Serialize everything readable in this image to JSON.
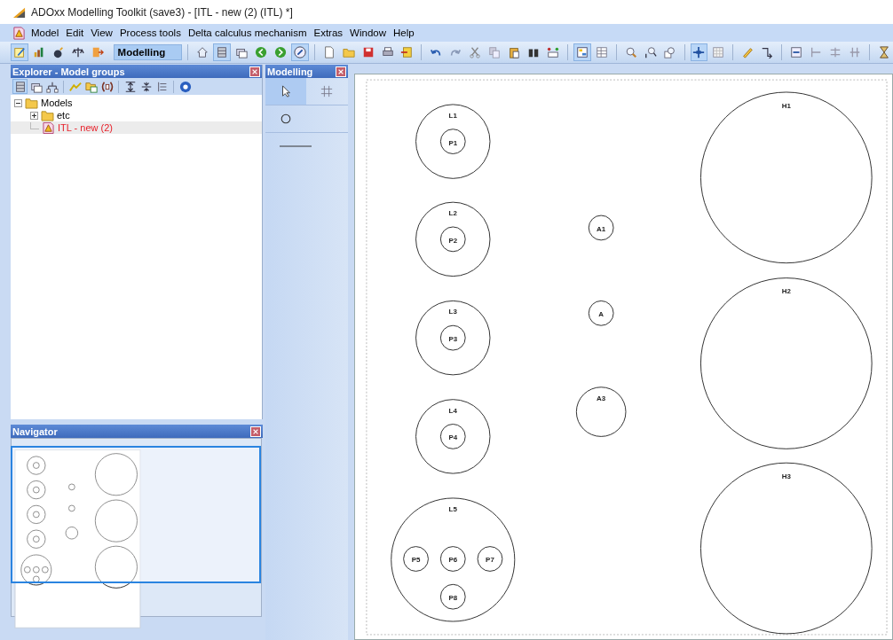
{
  "window": {
    "title": "ADOxx Modelling Toolkit (save3) - [ITL - new (2) (ITL) *]"
  },
  "menu": [
    "Model",
    "Edit",
    "View",
    "Process tools",
    "Delta calculus mechanism",
    "Extras",
    "Window",
    "Help"
  ],
  "toolbar": {
    "left_buttons": [
      {
        "pressed": true
      },
      {
        "pressed": false
      },
      {
        "pressed": false
      },
      {
        "pressed": false
      },
      {
        "pressed": false
      }
    ],
    "mode_field": {
      "value": "Modelling"
    },
    "buttons": [
      {
        "pressed": false
      },
      {
        "pressed": true
      },
      {
        "pressed": false
      },
      {
        "pressed": false
      },
      {
        "pressed": false
      },
      {
        "pressed": true
      },
      {
        "pressed": false
      },
      {
        "pressed": false
      },
      {
        "pressed": false
      },
      {
        "pressed": false
      },
      {
        "pressed": false
      },
      {
        "pressed": false
      },
      {
        "pressed": false
      },
      {
        "pressed": false
      },
      {
        "pressed": false
      },
      {
        "pressed": false
      },
      {
        "pressed": false
      },
      {
        "pressed": false
      },
      {
        "pressed": true
      },
      {
        "pressed": false
      },
      {
        "pressed": false
      },
      {
        "pressed": false
      },
      {
        "pressed": false
      },
      {
        "pressed": true
      },
      {
        "pressed": false
      },
      {
        "pressed": false
      },
      {
        "pressed": false
      },
      {
        "pressed": false
      },
      {
        "pressed": false
      },
      {
        "pressed": false
      },
      {
        "pressed": false
      },
      {
        "pressed": false
      }
    ]
  },
  "explorer": {
    "title": "Explorer - Model groups",
    "toolbar": [
      {
        "pressed": true
      },
      {
        "pressed": false
      },
      {
        "pressed": false
      },
      {
        "pressed": false
      },
      {
        "pressed": false
      },
      {
        "pressed": false
      },
      {
        "pressed": false
      },
      {
        "pressed": false
      },
      {
        "pressed": false
      },
      {
        "pressed": false
      }
    ],
    "tree": [
      {
        "label": "Models",
        "kind": "folder",
        "expanded": true,
        "selected": false,
        "children": [
          {
            "label": "etc",
            "kind": "folder",
            "expanded": false,
            "selected": false
          },
          {
            "label": "ITL - new (2)",
            "kind": "model",
            "open": true,
            "selected": true
          }
        ]
      }
    ]
  },
  "modelling": {
    "title": "Modelling",
    "tools": [
      {
        "kind": "pointer",
        "selected": true
      },
      {
        "kind": "grid",
        "selected": false
      },
      {
        "kind": "circle",
        "selected": false
      },
      {
        "kind": "line",
        "selected": false
      }
    ]
  },
  "navigator": {
    "title": "Navigator"
  },
  "diagram": {
    "nodes": [
      {
        "label": "L1",
        "kind": "container",
        "children": [
          {
            "label": "P1",
            "kind": "small"
          }
        ]
      },
      {
        "label": "L2",
        "kind": "container",
        "children": [
          {
            "label": "P2",
            "kind": "small"
          }
        ]
      },
      {
        "label": "L3",
        "kind": "container",
        "children": [
          {
            "label": "P3",
            "kind": "small"
          }
        ]
      },
      {
        "label": "L4",
        "kind": "container",
        "children": [
          {
            "label": "P4",
            "kind": "small"
          }
        ]
      },
      {
        "label": "L5",
        "kind": "container",
        "children": [
          {
            "label": "P5",
            "kind": "small"
          },
          {
            "label": "P6",
            "kind": "small"
          },
          {
            "label": "P7",
            "kind": "small"
          },
          {
            "label": "P8",
            "kind": "small"
          }
        ]
      },
      {
        "label": "A1",
        "kind": "small"
      },
      {
        "label": "A",
        "kind": "small"
      },
      {
        "label": "A3",
        "kind": "medium"
      },
      {
        "label": "H1",
        "kind": "large"
      },
      {
        "label": "H2",
        "kind": "large"
      },
      {
        "label": "H3",
        "kind": "large"
      }
    ]
  }
}
